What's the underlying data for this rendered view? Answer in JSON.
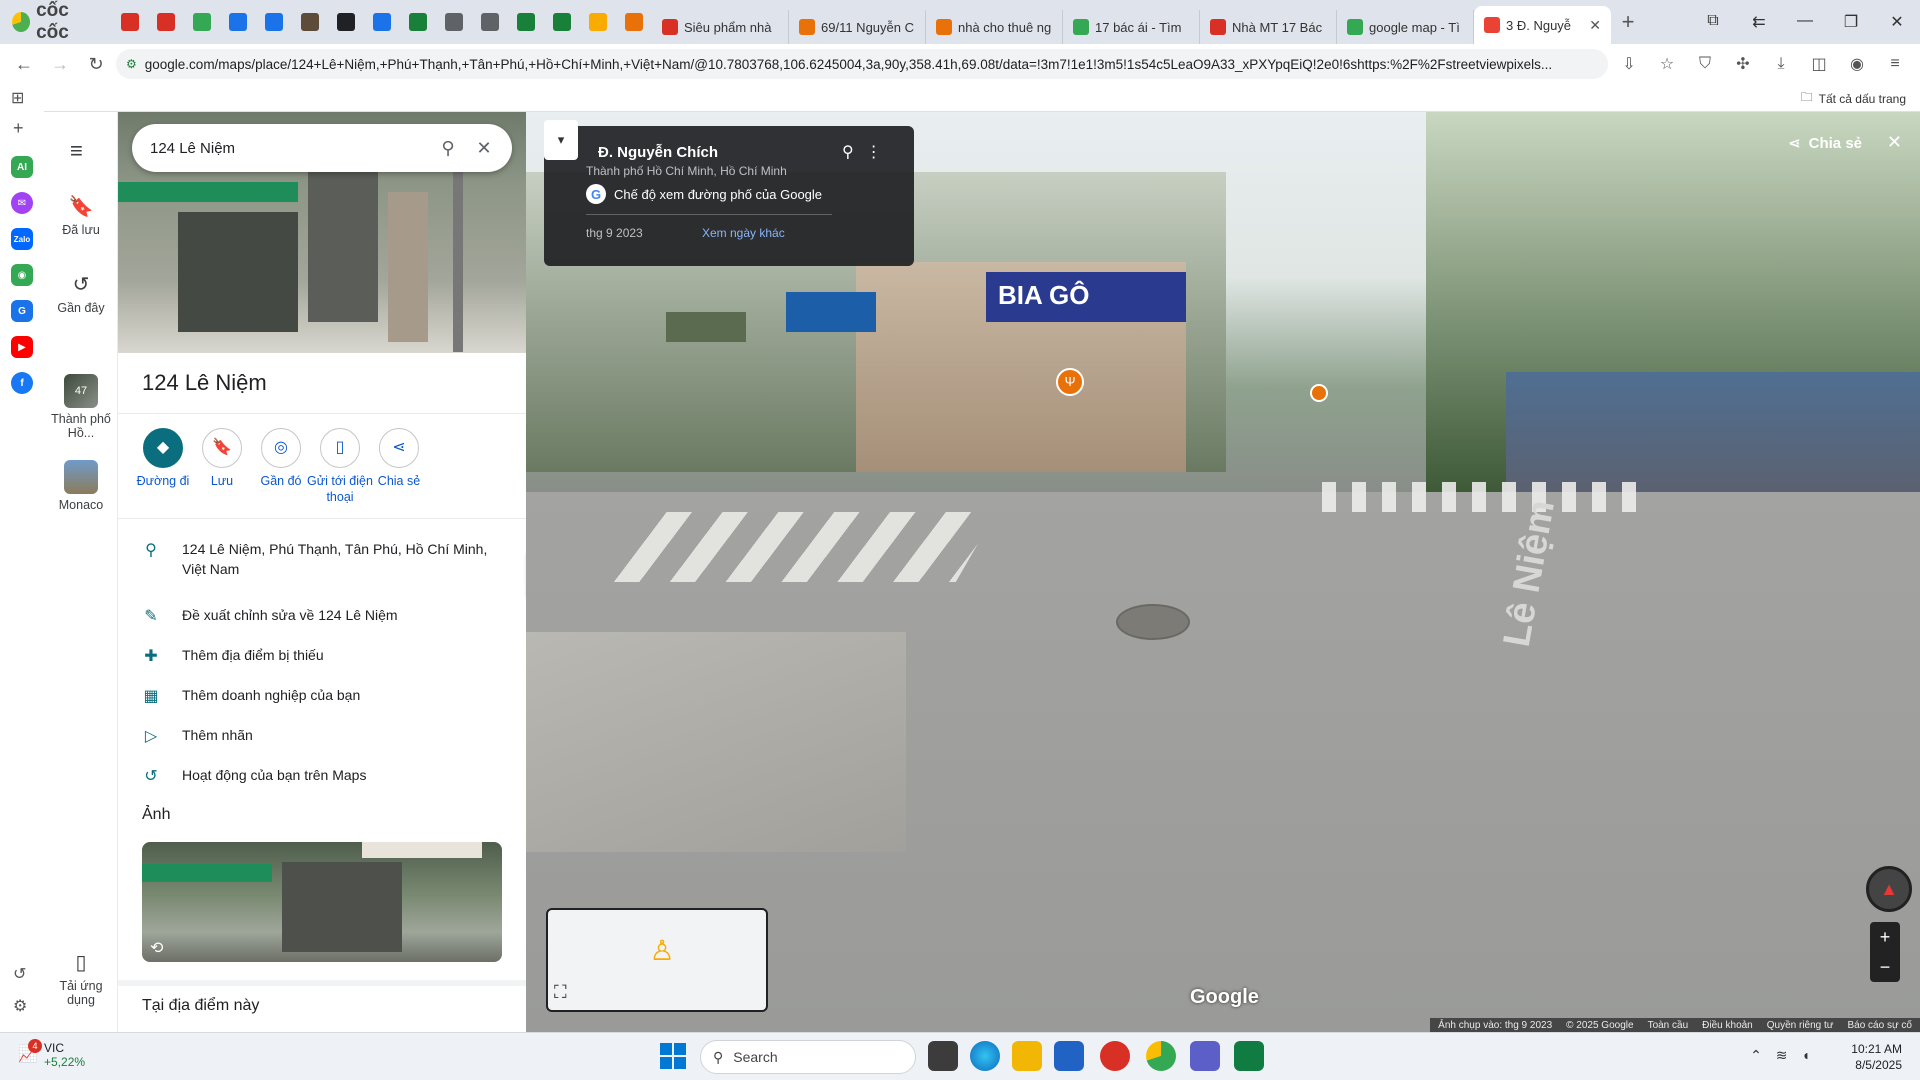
{
  "browser": {
    "brand": "cốc cốc",
    "tabs": [
      {
        "title": "Siêu phẩm nhà",
        "color": "#d93025"
      },
      {
        "title": "69/11 Nguyễn C",
        "color": "#e8710a"
      },
      {
        "title": "nhà cho thuê ng",
        "color": "#e8710a"
      },
      {
        "title": "17 bác ái - Tìm",
        "color": "#34a853"
      },
      {
        "title": "Nhà MT 17 Bác",
        "color": "#d93025"
      },
      {
        "title": "google map - Tì",
        "color": "#34a853"
      },
      {
        "title": "3 Đ. Nguyễ",
        "color": "#ea4335",
        "close": "✕"
      }
    ],
    "pinned_colors": [
      "#d93025",
      "#d93025",
      "#34a853",
      "#1a73e8",
      "#1a73e8",
      "#5f4b3a",
      "#202124",
      "#1a73e8",
      "#188038",
      "#5f6368",
      "#5f6368",
      "#188038",
      "#188038",
      "#f9ab00",
      "#e8710a"
    ],
    "new_tab": "+",
    "url": "google.com/maps/place/124+Lê+Niệm,+Phú+Thạnh,+Tân+Phú,+Hồ+Chí+Minh,+Việt+Nam/@10.7803768,106.6245004,3a,90y,358.41h,69.08t/data=!3m7!1e1!3m5!1s54c5LeaO9A33_xPXYpqEiQ!2e0!6shttps:%2F%2Fstreetviewpixels...",
    "bookmarks_all": "Tất cả dấu trang"
  },
  "rail": {
    "saved": "Đã lưu",
    "recent": "Gần đây",
    "place1": "Thành phố Hồ...",
    "place1_badge": "47",
    "place2": "Monaco",
    "apps": "Tải ứng dụng"
  },
  "panel": {
    "search_value": "124 Lê Niệm",
    "title": "124 Lê Niệm",
    "actions": [
      {
        "label": "Đường đi",
        "icon": "◆"
      },
      {
        "label": "Lưu",
        "icon": "🔖"
      },
      {
        "label": "Gần đó",
        "icon": "◎"
      },
      {
        "label": "Gửi tới điện thoại",
        "icon": "▯"
      },
      {
        "label": "Chia sẻ",
        "icon": "⋖"
      }
    ],
    "info": [
      {
        "text": "124 Lê Niệm, Phú Thạnh, Tân Phú, Hồ Chí Minh, Việt Nam",
        "icon": "⚲"
      },
      {
        "text": "Đề xuất chỉnh sửa về 124 Lê Niệm",
        "icon": "✎"
      },
      {
        "text": "Thêm địa điểm bị thiếu",
        "icon": "✚"
      },
      {
        "text": "Thêm doanh nghiệp của bạn",
        "icon": "▦"
      },
      {
        "text": "Thêm nhãn",
        "icon": "▷"
      },
      {
        "text": "Hoạt động của bạn trên Maps",
        "icon": "↺"
      }
    ],
    "photos_heading": "Ảnh",
    "at_place": "Tại địa điểm này"
  },
  "streetview": {
    "street": "Đ. Nguyễn Chích",
    "city": "Thành phố Hồ Chí Minh, Hồ Chí Minh",
    "mode": "Chế độ xem đường phố của Google",
    "date": "thg 9 2023",
    "other_dates": "Xem ngày khác",
    "share": "Chia sẻ",
    "google": "Google",
    "footer": [
      "Ảnh chụp vào: thg 9 2023",
      "© 2025 Google",
      "Toàn cầu",
      "Điều khoản",
      "Quyền riêng tư",
      "Báo cáo sự cố"
    ]
  },
  "taskbar": {
    "weather_name": "VIC",
    "weather_change": "+5,22%",
    "weather_badge": "4",
    "search": "Search",
    "time": "10:21 AM",
    "date": "8/5/2025"
  }
}
